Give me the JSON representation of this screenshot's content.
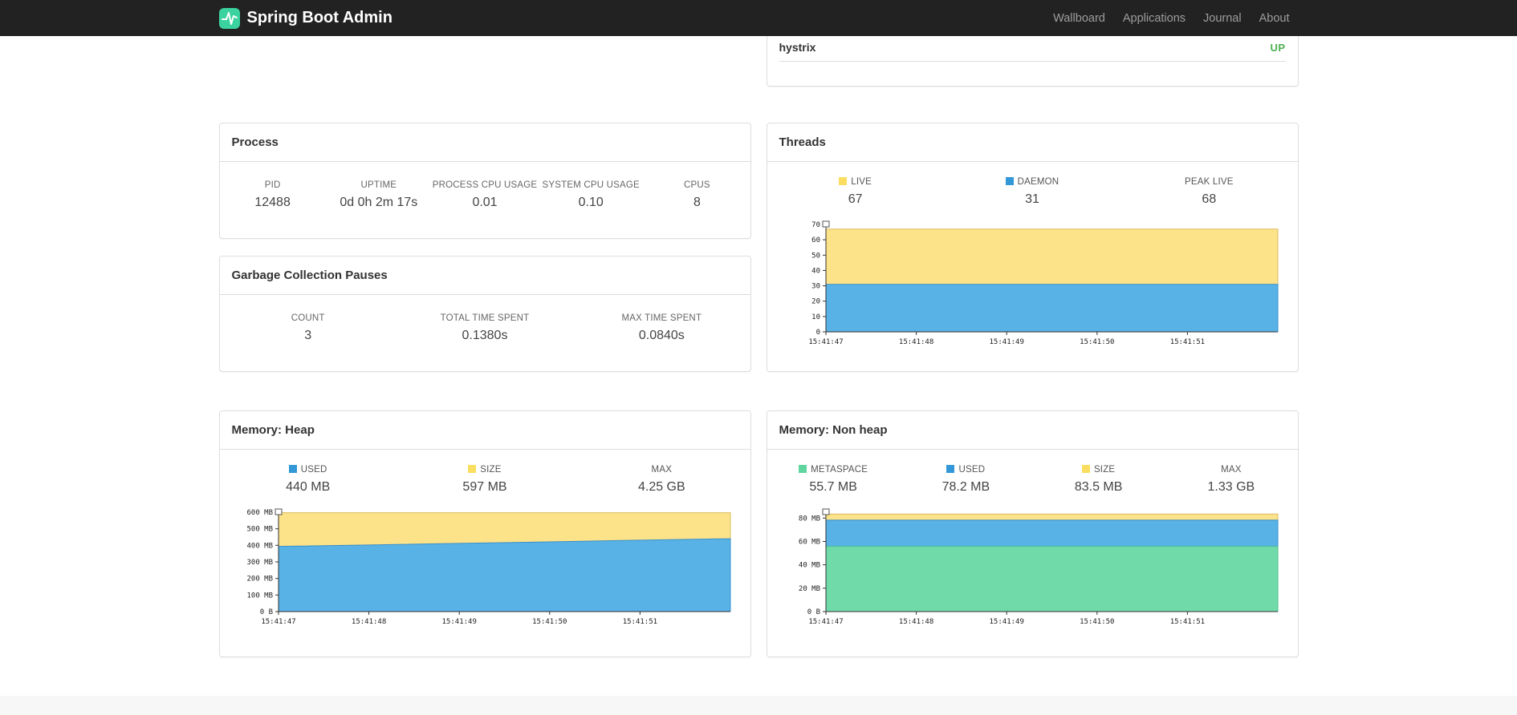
{
  "navbar": {
    "brand": "Spring Boot Admin",
    "links": [
      "Wallboard",
      "Applications",
      "Journal",
      "About"
    ]
  },
  "applications_panel": {
    "app_name": "hystrix",
    "status": "UP"
  },
  "colors": {
    "navbar_bg": "#222222",
    "brand_green": "#3ad29f",
    "status_up": "#4caf50",
    "chart_yellow": "#fce289",
    "chart_blue": "#58b2e6",
    "chart_green": "#70dba9"
  },
  "process": {
    "title": "Process",
    "metrics": [
      {
        "label": "PID",
        "value": "12488"
      },
      {
        "label": "UPTIME",
        "value": "0d 0h 2m 17s"
      },
      {
        "label": "PROCESS CPU USAGE",
        "value": "0.01"
      },
      {
        "label": "SYSTEM CPU USAGE",
        "value": "0.10"
      },
      {
        "label": "CPUS",
        "value": "8"
      }
    ]
  },
  "gc": {
    "title": "Garbage Collection Pauses",
    "metrics": [
      {
        "label": "COUNT",
        "value": "3"
      },
      {
        "label": "TOTAL TIME SPENT",
        "value": "0.1380s"
      },
      {
        "label": "MAX TIME SPENT",
        "value": "0.0840s"
      }
    ]
  },
  "threads": {
    "title": "Threads",
    "legend": [
      {
        "label": "LIVE",
        "value": "67",
        "color": "#fbde60"
      },
      {
        "label": "DAEMON",
        "value": "31",
        "color": "#3398d8"
      },
      {
        "label": "PEAK LIVE",
        "value": "68"
      }
    ]
  },
  "memory_heap": {
    "title": "Memory: Heap",
    "legend": [
      {
        "label": "USED",
        "value": "440 MB",
        "color": "#3398d8"
      },
      {
        "label": "SIZE",
        "value": "597 MB",
        "color": "#fbde60"
      },
      {
        "label": "MAX",
        "value": "4.25 GB"
      }
    ]
  },
  "memory_nonheap": {
    "title": "Memory: Non heap",
    "legend": [
      {
        "label": "METASPACE",
        "value": "55.7 MB",
        "color": "#5fd5a0"
      },
      {
        "label": "USED",
        "value": "78.2 MB",
        "color": "#3398d8"
      },
      {
        "label": "SIZE",
        "value": "83.5 MB",
        "color": "#fbde60"
      },
      {
        "label": "MAX",
        "value": "1.33 GB"
      }
    ]
  },
  "chart_data": [
    {
      "id": "threads",
      "type": "area",
      "title": "Threads",
      "xlabel": "",
      "ylabel": "",
      "legend_position": "top",
      "grid": false,
      "ymax": 70,
      "x_ticks": [
        "15:41:47",
        "15:41:48",
        "15:41:49",
        "15:41:50",
        "15:41:51"
      ],
      "y_ticks": [
        {
          "label": "0",
          "value": 0
        },
        {
          "label": "10",
          "value": 10
        },
        {
          "label": "20",
          "value": 20
        },
        {
          "label": "30",
          "value": 30
        },
        {
          "label": "40",
          "value": 40
        },
        {
          "label": "50",
          "value": 50
        },
        {
          "label": "60",
          "value": 60
        },
        {
          "label": "70",
          "value": 70
        }
      ],
      "series": [
        {
          "name": "LIVE",
          "fill": "#fce289",
          "stroke": "#dabd62",
          "values": [
            67,
            67,
            67,
            67,
            67,
            67
          ]
        },
        {
          "name": "DAEMON",
          "fill": "#58b2e6",
          "stroke": "#3a90cc",
          "values": [
            31,
            31,
            31,
            31,
            31,
            31
          ]
        }
      ]
    },
    {
      "id": "memory-heap",
      "type": "area",
      "title": "Memory: Heap",
      "xlabel": "",
      "ylabel": "",
      "legend_position": "top",
      "grid": false,
      "ymax": 600,
      "x_ticks": [
        "15:41:47",
        "15:41:48",
        "15:41:49",
        "15:41:50",
        "15:41:51"
      ],
      "y_ticks": [
        {
          "label": "0 B",
          "value": 0
        },
        {
          "label": "100 MB",
          "value": 100
        },
        {
          "label": "200 MB",
          "value": 200
        },
        {
          "label": "300 MB",
          "value": 300
        },
        {
          "label": "400 MB",
          "value": 400
        },
        {
          "label": "500 MB",
          "value": 500
        },
        {
          "label": "600 MB",
          "value": 600
        }
      ],
      "series": [
        {
          "name": "SIZE",
          "fill": "#fce289",
          "stroke": "#dabd62",
          "values": [
            597,
            597,
            597,
            597,
            597,
            597
          ]
        },
        {
          "name": "USED",
          "fill": "#58b2e6",
          "stroke": "#3a90cc",
          "values": [
            394,
            402,
            412,
            421,
            431,
            440
          ]
        }
      ]
    },
    {
      "id": "memory-nonheap",
      "type": "area",
      "title": "Memory: Non heap",
      "xlabel": "",
      "ylabel": "",
      "legend_position": "top",
      "grid": false,
      "ymax": 85,
      "x_ticks": [
        "15:41:47",
        "15:41:48",
        "15:41:49",
        "15:41:50",
        "15:41:51"
      ],
      "y_ticks": [
        {
          "label": "0 B",
          "value": 0
        },
        {
          "label": "20 MB",
          "value": 20
        },
        {
          "label": "40 MB",
          "value": 40
        },
        {
          "label": "60 MB",
          "value": 60
        },
        {
          "label": "80 MB",
          "value": 80
        }
      ],
      "series": [
        {
          "name": "SIZE",
          "fill": "#fce289",
          "stroke": "#dabd62",
          "values": [
            83.5,
            83.5,
            83.5,
            83.5,
            83.5,
            83.5
          ]
        },
        {
          "name": "USED",
          "fill": "#58b2e6",
          "stroke": "#3a90cc",
          "values": [
            78.2,
            78.2,
            78.2,
            78.2,
            78.2,
            78.2
          ]
        },
        {
          "name": "METASPACE",
          "fill": "#70dba9",
          "stroke": "#4ac28b",
          "values": [
            55.7,
            55.7,
            55.7,
            55.7,
            55.7,
            55.7
          ]
        }
      ]
    }
  ]
}
